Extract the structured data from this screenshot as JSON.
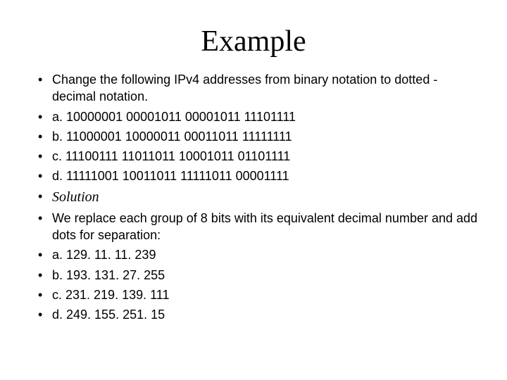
{
  "title": "Example",
  "bullets": {
    "prompt": "Change the following IPv4 addresses from binary notation to dotted -decimal notation.",
    "q_a": "a. 10000001  00001011  00001011  11101111",
    "q_b": "b. 11000001  10000011  00011011  11111111",
    "q_c": "c. 11100111  11011011  10001011  01101111",
    "q_d": "d. 11111001  10011011  11111011  00001111",
    "solution_label": "Solution",
    "solution_intro": "We replace each group of 8 bits with its equivalent decimal number and add dots for separation:",
    "a_a": "a. 129. 11. 11. 239",
    "a_b": "b. 193. 131. 27. 255",
    "a_c": "c. 231. 219. 139. 111",
    "a_d": "d. 249. 155. 251. 15"
  }
}
